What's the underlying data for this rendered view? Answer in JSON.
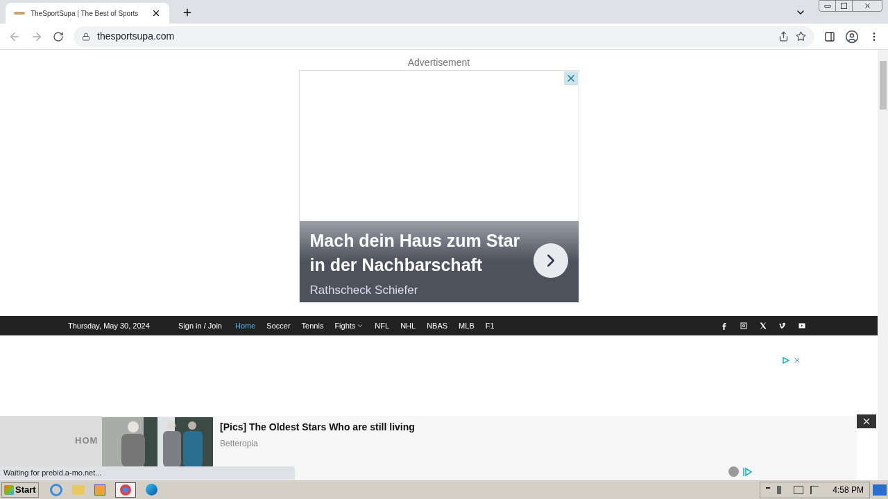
{
  "browser": {
    "tab_title": "TheSportSupa | The Best of Sports",
    "url": "thesportsupa.com"
  },
  "ad_label": "Advertisement",
  "top_ad": {
    "headline": "Mach dein Haus zum Star in der Nachbarschaft",
    "advertiser": "Rathscheck Schiefer"
  },
  "nav": {
    "date": "Thursday, May 30, 2024",
    "sign_in": "Sign in / Join",
    "items": [
      {
        "label": "Home",
        "selected": true,
        "kind": "link"
      },
      {
        "label": "Soccer",
        "selected": false,
        "kind": "link"
      },
      {
        "label": "Tennis",
        "selected": false,
        "kind": "link"
      },
      {
        "label": "Fights",
        "selected": false,
        "kind": "dropdown"
      },
      {
        "label": "NFL",
        "selected": false,
        "kind": "link"
      },
      {
        "label": "NHL",
        "selected": false,
        "kind": "link"
      },
      {
        "label": "NBAS",
        "selected": false,
        "kind": "link"
      },
      {
        "label": "MLB",
        "selected": false,
        "kind": "link"
      },
      {
        "label": "F1",
        "selected": false,
        "kind": "link"
      }
    ]
  },
  "behind_text": "HOM",
  "sticky_ad": {
    "title": "[Pics] The Oldest Stars Who are still living",
    "source": "Betteropia"
  },
  "status": "Waiting for prebid.a-mo.net...",
  "taskbar": {
    "start": "Start",
    "clock": "4:58 PM"
  }
}
